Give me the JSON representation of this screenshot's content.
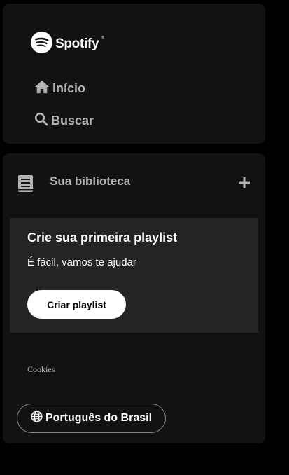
{
  "brand": {
    "name": "Spotify",
    "trademark": "®",
    "logo_icon": "spotify-logo-icon"
  },
  "nav": {
    "items": [
      {
        "label": "Início",
        "icon": "home-icon"
      },
      {
        "label": "Buscar",
        "icon": "search-icon"
      }
    ]
  },
  "library": {
    "title": "Sua biblioteca",
    "icon": "library-icon",
    "add_icon": "plus-icon",
    "card": {
      "title": "Crie sua primeira playlist",
      "subtitle": "É fácil, vamos te ajudar",
      "button_label": "Criar playlist"
    },
    "cookies_label": "Cookies",
    "language_button": {
      "label": "Português do Brasil",
      "icon": "globe-icon"
    }
  },
  "colors": {
    "background": "#000000",
    "panel": "#121212",
    "card": "#242424",
    "text_primary": "#ffffff",
    "text_secondary": "#b3b3b3",
    "button_bg": "#ffffff",
    "button_text": "#000000",
    "outline": "#878787"
  }
}
